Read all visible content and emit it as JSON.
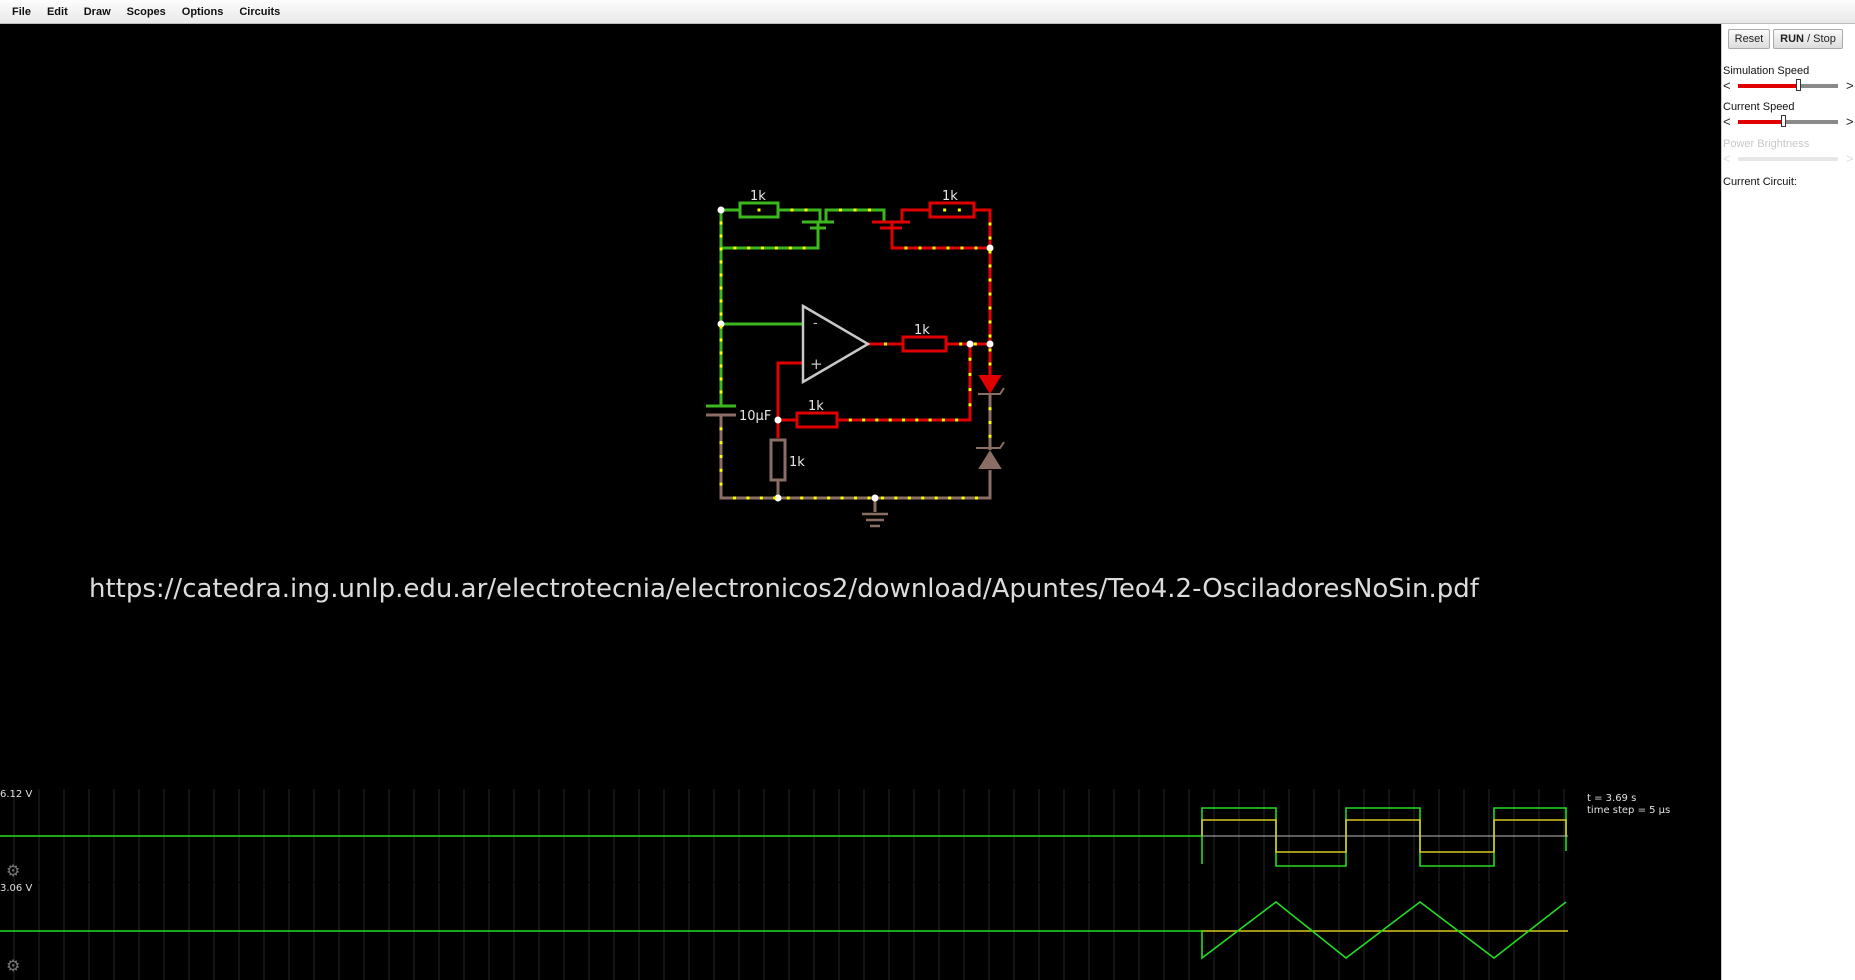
{
  "menu": [
    "File",
    "Edit",
    "Draw",
    "Scopes",
    "Options",
    "Circuits"
  ],
  "sidebar": {
    "reset_label": "Reset",
    "run_label_bold": "RUN",
    "run_label_rest": " / Stop",
    "simulation_speed": {
      "label": "Simulation Speed",
      "value": 0.6
    },
    "current_speed": {
      "label": "Current Speed",
      "value": 0.45
    },
    "power_brightness": {
      "label": "Power Brightness",
      "value": 0.0
    },
    "current_circuit_label": "Current Circuit:"
  },
  "circuit": {
    "labels": [
      "1k",
      "1k",
      "1k",
      "1k",
      "1k",
      "10µF"
    ],
    "opamp_minus": "-",
    "opamp_plus": "+",
    "source_url": "https://catedra.ing.unlp.edu.ar/electrotecnia/electronicos2/download/Apuntes/Teo4.2-OsciladoresNoSin.pdf"
  },
  "scopes": {
    "scope1_max": "6.12 V",
    "scope2_max": "3.06 V",
    "time_readout": "t = 3.69 s",
    "timestep_readout": "time step = 5 µs"
  },
  "colors": {
    "background": "#000000",
    "wire_low": "#3cb81e",
    "wire_high": "#e00000",
    "wire_neutral": "#8a6e64",
    "current_dot": "#ffff00",
    "scope_green": "#22dd22",
    "scope_yellow": "#d8c820",
    "scope_grid": "#333333"
  }
}
